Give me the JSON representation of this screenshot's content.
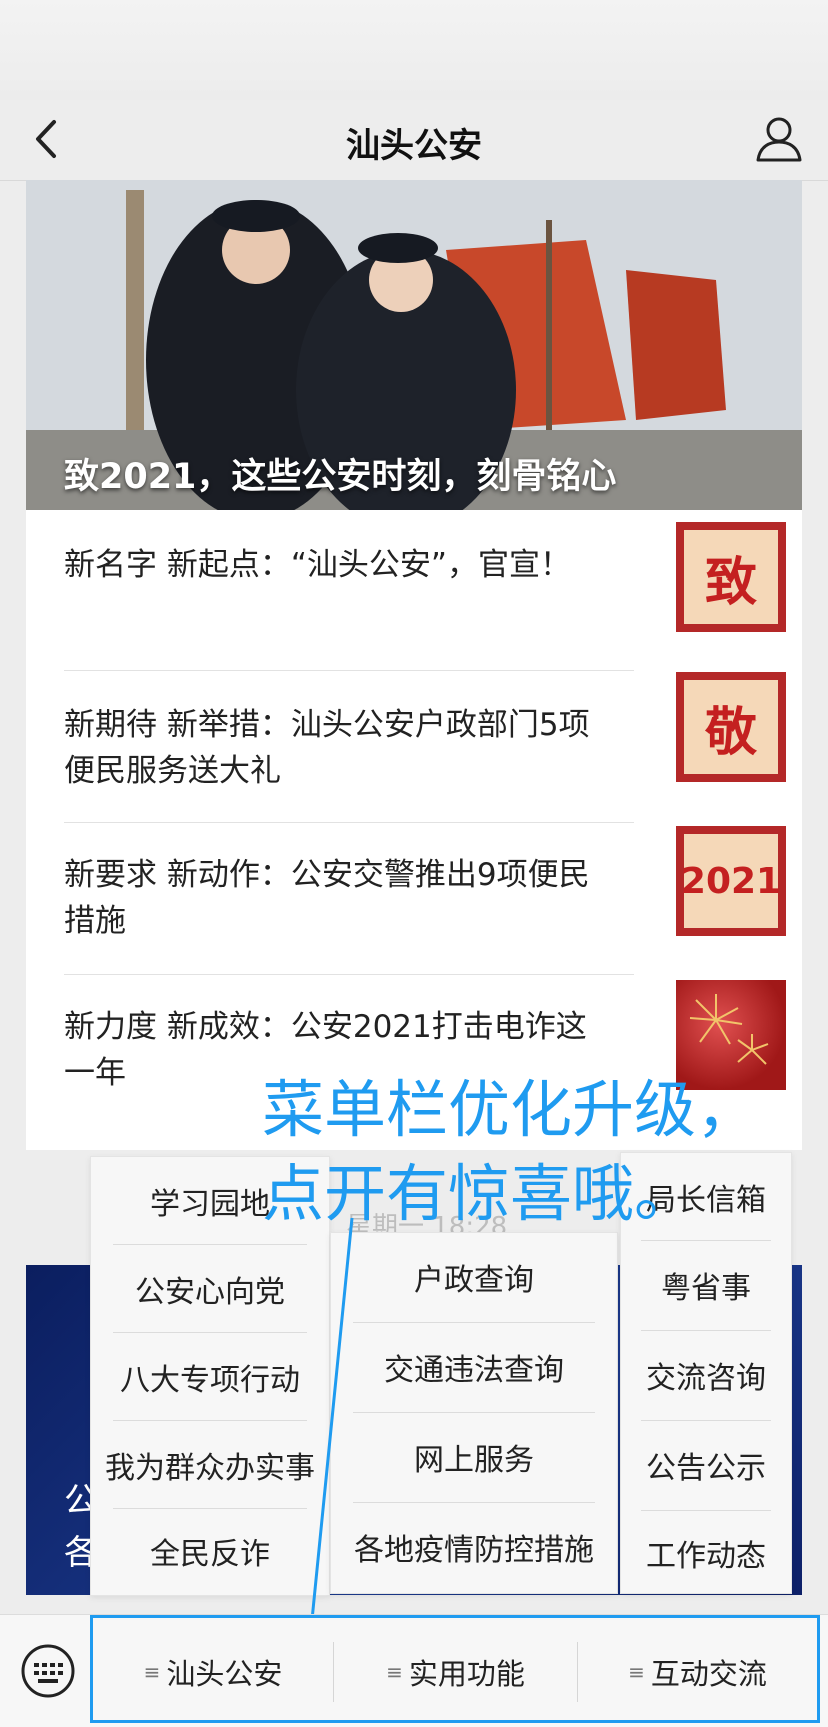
{
  "header": {
    "title": "汕头公安",
    "back_icon": "chevron-left-icon",
    "profile_icon": "person-icon"
  },
  "hero": {
    "caption": "致2021，这些公安时刻，刻骨铭心"
  },
  "news": [
    {
      "title": "新名字 新起点：“汕头公安”，官宣！",
      "thumb": "致"
    },
    {
      "title": "新期待 新举措：汕头公安户政部门5项便民服务送大礼",
      "thumb": "敬"
    },
    {
      "title": "新要求 新动作：公安交警推出9项便民措施",
      "thumb": "2021"
    },
    {
      "title": "新力度 新成效：公安2021打击电诈这一年",
      "thumb": ""
    }
  ],
  "banner2": {
    "line1": "公",
    "line2": "各"
  },
  "timestamp": "星期一 18:28",
  "overlay": {
    "line1": "菜单栏优化升级，",
    "line2": "点开有惊喜哦。"
  },
  "menus": {
    "left": [
      "学习园地",
      "公安心向党",
      "八大专项行动",
      "我为群众办实事",
      "全民反诈"
    ],
    "middle": [
      "户政查询",
      "交通违法查询",
      "网上服务",
      "各地疫情防控措施"
    ],
    "right": [
      "局长信箱",
      "粤省事",
      "交流咨询",
      "公告公示",
      "工作动态"
    ]
  },
  "bottom_bar": {
    "keyboard_icon": "keyboard-icon",
    "tabs": [
      "汕头公安",
      "实用功能",
      "互动交流"
    ],
    "tab_mark": "≡"
  },
  "colors": {
    "accent": "#1f9bf0",
    "thumb_red": "#c42020"
  }
}
